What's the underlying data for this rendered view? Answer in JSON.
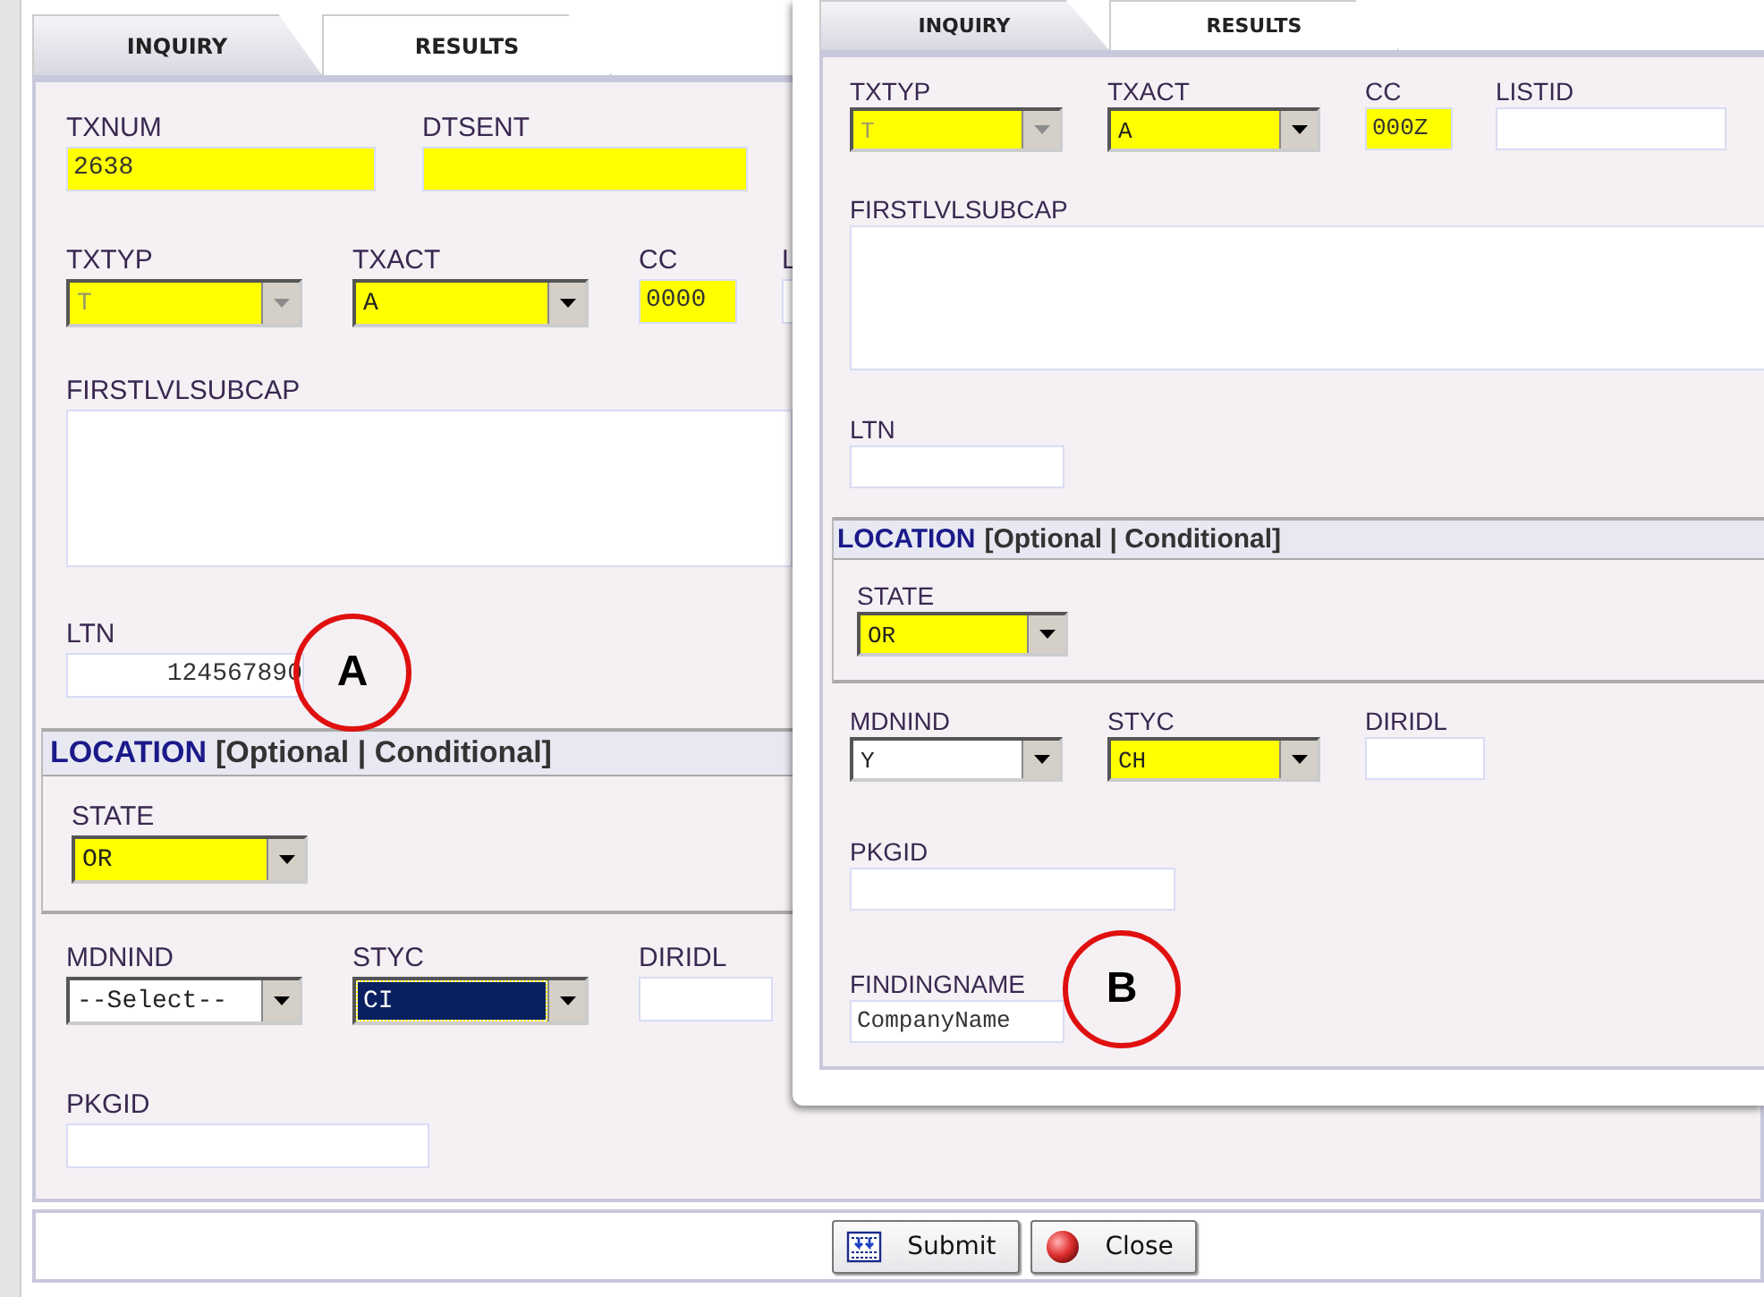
{
  "back_window": {
    "tabs": [
      {
        "label": "INQUIRY",
        "selected": true
      },
      {
        "label": "RESULTS",
        "selected": false
      }
    ],
    "rows": [
      [
        {
          "label": "TXNUM",
          "kind": "text",
          "value": "2638",
          "highlighted": true
        },
        {
          "label": "DTSENT",
          "kind": "text",
          "highlighted": true
        }
      ],
      [
        {
          "label": "TXTYP",
          "kind": "select",
          "value": "T",
          "highlighted": true,
          "disabled": true,
          "focused": false
        },
        {
          "label": "TXACT",
          "kind": "select",
          "value": "A",
          "highlighted": true,
          "disabled": false,
          "focused": false
        },
        {
          "label": "CC",
          "kind": "text",
          "value": "0000",
          "highlighted": true
        },
        {
          "label": "L",
          "kind": "text",
          "highlighted": false
        }
      ],
      [
        {
          "label": "FIRSTLVLSUBCAP",
          "kind": "textarea"
        }
      ],
      [
        {
          "label": "LTN",
          "kind": "number",
          "value": "124567890",
          "highlighted": false
        }
      ]
    ],
    "section": {
      "title": "LOCATION",
      "subtitle": "[Optional | Conditional]",
      "rows": [
        [
          {
            "label": "STATE",
            "kind": "select",
            "value": "OR",
            "highlighted": true,
            "disabled": false,
            "focused": false
          }
        ]
      ]
    },
    "rows_after": [
      [
        {
          "label": "MDNIND",
          "kind": "select",
          "value": "--Select--",
          "highlighted": false,
          "disabled": false,
          "focused": false
        },
        {
          "label": "STYC",
          "kind": "select",
          "value": "CI",
          "highlighted": false,
          "disabled": false,
          "focused": true
        },
        {
          "label": "DIRIDL",
          "kind": "text",
          "highlighted": false
        }
      ],
      [
        {
          "label": "PKGID",
          "kind": "text",
          "highlighted": false
        }
      ]
    ],
    "buttons": [
      {
        "label": "Submit"
      },
      {
        "label": "Close"
      }
    ]
  },
  "front_window": {
    "tabs": [
      {
        "label": "INQUIRY",
        "selected": true
      },
      {
        "label": "RESULTS",
        "selected": false
      }
    ],
    "rows": [
      [
        {
          "label": "TXTYP",
          "kind": "select",
          "value": "T",
          "highlighted": true,
          "disabled": true,
          "focused": false
        },
        {
          "label": "TXACT",
          "kind": "select",
          "value": "A",
          "highlighted": true,
          "disabled": false,
          "focused": false
        },
        {
          "label": "CC",
          "kind": "text",
          "value": "000Z",
          "highlighted": true
        },
        {
          "label": "LISTID",
          "kind": "text",
          "highlighted": false
        }
      ],
      [
        {
          "label": "FIRSTLVLSUBCAP",
          "kind": "textarea"
        }
      ],
      [
        {
          "label": "LTN",
          "kind": "text",
          "highlighted": false
        }
      ]
    ],
    "section": {
      "title": "LOCATION",
      "subtitle": "[Optional | Conditional]",
      "rows": [
        [
          {
            "label": "STATE",
            "kind": "select",
            "value": "OR",
            "highlighted": true,
            "disabled": false,
            "focused": false
          }
        ]
      ]
    },
    "rows_after": [
      [
        {
          "label": "MDNIND",
          "kind": "select",
          "value": "Y",
          "highlighted": false,
          "disabled": false,
          "focused": false
        },
        {
          "label": "STYC",
          "kind": "select",
          "value": "CH",
          "highlighted": true,
          "disabled": false,
          "focused": false
        },
        {
          "label": "DIRIDL",
          "kind": "text",
          "highlighted": false
        }
      ],
      [
        {
          "label": "PKGID",
          "kind": "text",
          "highlighted": false
        }
      ],
      [
        {
          "label": "FINDINGNAME",
          "kind": "text",
          "value": "CompanyName",
          "highlighted": false
        }
      ]
    ]
  },
  "annotations": [
    {
      "label": "A"
    },
    {
      "label": "B"
    }
  ]
}
